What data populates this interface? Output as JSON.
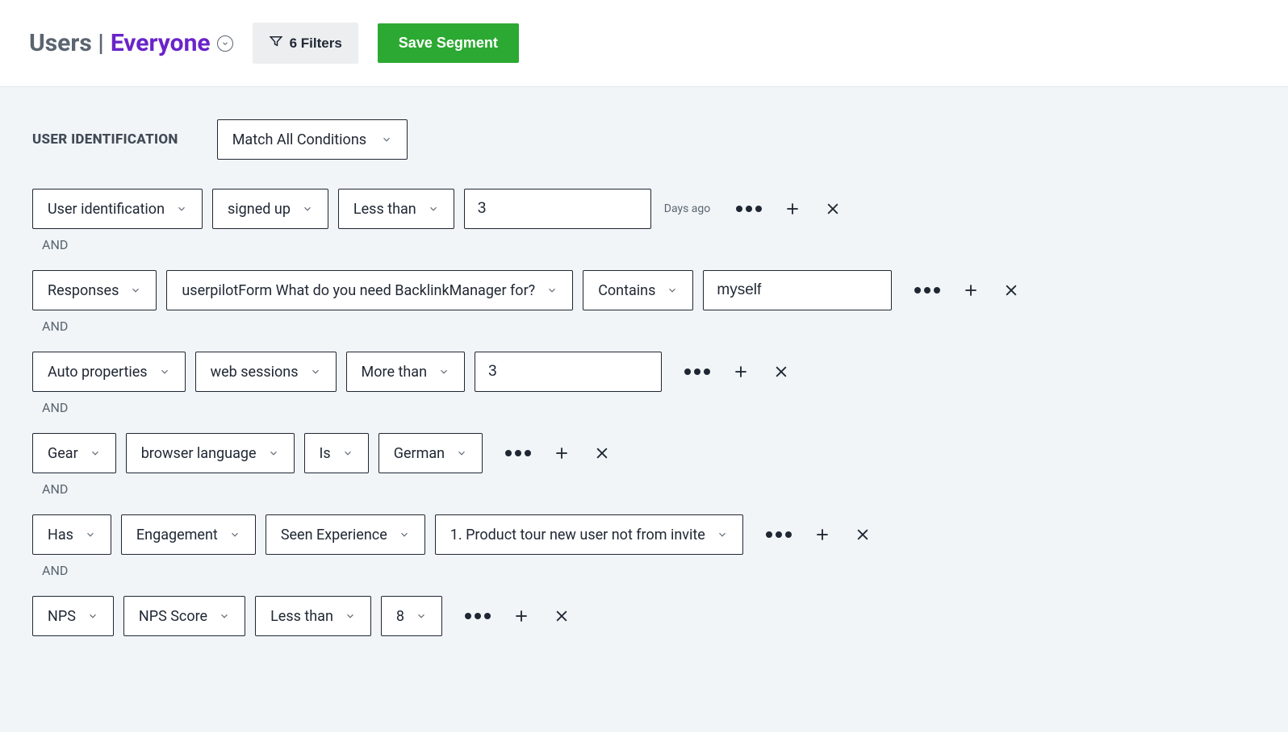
{
  "header": {
    "title_prefix": "Users |",
    "segment_name": "Everyone",
    "filter_label": "6 Filters",
    "save_label": "Save Segment"
  },
  "section": {
    "label": "USER IDENTIFICATION",
    "match_mode": "Match All Conditions"
  },
  "conditions": [
    {
      "selects": [
        "User identification",
        "signed up",
        "Less than"
      ],
      "input": "3",
      "after_input_text": "Days ago",
      "join": "AND"
    },
    {
      "selects": [
        "Responses",
        "userpilotForm What do you need BacklinkManager for?",
        "Contains"
      ],
      "input": "myself",
      "after_input_text": null,
      "join": "AND"
    },
    {
      "selects": [
        "Auto properties",
        "web sessions",
        "More than"
      ],
      "input": "3",
      "after_input_text": null,
      "join": "AND"
    },
    {
      "selects": [
        "Gear",
        "browser language",
        "Is",
        "German"
      ],
      "input": null,
      "after_input_text": null,
      "join": "AND"
    },
    {
      "selects": [
        "Has",
        "Engagement",
        "Seen Experience",
        "1. Product tour new user not from invite"
      ],
      "input": null,
      "after_input_text": null,
      "join": "AND"
    },
    {
      "selects": [
        "NPS",
        "NPS Score",
        "Less than",
        "8"
      ],
      "input": null,
      "after_input_text": null,
      "join": null
    }
  ]
}
